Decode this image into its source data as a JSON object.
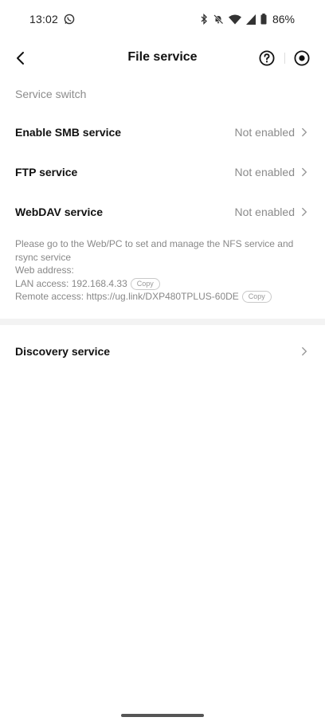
{
  "status_bar": {
    "time": "13:02",
    "battery": "86%",
    "icons": [
      "whatsapp-icon",
      "bluetooth-icon",
      "mute-icon",
      "wifi-icon",
      "signal-icon",
      "battery-icon"
    ]
  },
  "header": {
    "title": "File service",
    "back_icon": "back-arrow-icon",
    "help_icon": "help-circle-icon",
    "record_icon": "record-icon"
  },
  "section_title": "Service switch",
  "services": [
    {
      "label": "Enable SMB service",
      "value": "Not enabled"
    },
    {
      "label": "FTP service",
      "value": "Not enabled"
    },
    {
      "label": "WebDAV service",
      "value": "Not enabled"
    }
  ],
  "info": {
    "note": "Please go to the Web/PC to set and manage the NFS service and rsync service",
    "web_address_label": "Web address:",
    "lan_access": "LAN access: 192.168.4.33",
    "remote_access": "Remote access: https://ug.link/DXP480TPLUS-60DE",
    "copy_label": "Copy"
  },
  "discovery": {
    "label": "Discovery service"
  },
  "colors": {
    "primary_text": "#111111",
    "secondary_text": "#8a8a8a",
    "divider": "#f3f3f3",
    "background": "#ffffff"
  }
}
